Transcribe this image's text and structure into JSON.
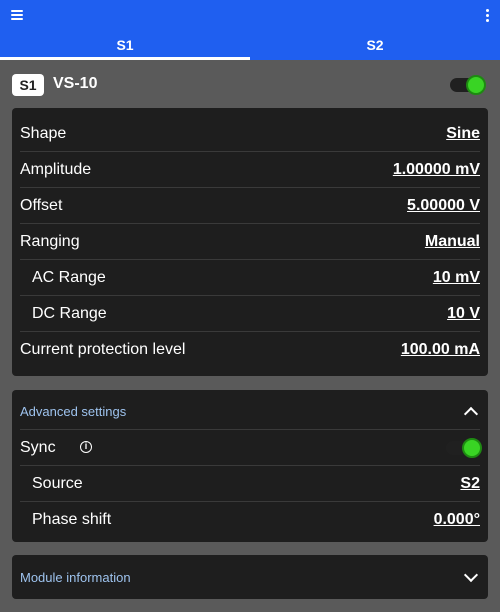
{
  "topbar": {
    "menu_icon": "menu-icon",
    "overflow_icon": "kebab-icon"
  },
  "tabs": [
    {
      "label": "S1",
      "active": true
    },
    {
      "label": "S2",
      "active": false
    }
  ],
  "header": {
    "badge": "S1",
    "device_name": "VS-10",
    "enabled": true
  },
  "settings": {
    "shape": {
      "label": "Shape",
      "value": "Sine"
    },
    "amplitude": {
      "label": "Amplitude",
      "value": "1.00000 mV"
    },
    "offset": {
      "label": "Offset",
      "value": "5.00000 V"
    },
    "ranging": {
      "label": "Ranging",
      "value": "Manual"
    },
    "ac_range": {
      "label": "AC Range",
      "value": "10 mV"
    },
    "dc_range": {
      "label": "DC Range",
      "value": "10 V"
    },
    "current_protection": {
      "label": "Current protection level",
      "value": "100.00 mA"
    }
  },
  "advanced": {
    "title": "Advanced settings",
    "sync": {
      "label": "Sync",
      "enabled": true
    },
    "source": {
      "label": "Source",
      "value": "S2"
    },
    "phase_shift": {
      "label": "Phase shift",
      "value": "0.000°"
    }
  },
  "module_info": {
    "title": "Module information"
  },
  "colors": {
    "accent": "#1f5ff0",
    "toggle_on": "#39d424",
    "section_title": "#9ec3ee",
    "card_bg": "#1e1e1e",
    "page_bg": "#5a5a5a"
  }
}
